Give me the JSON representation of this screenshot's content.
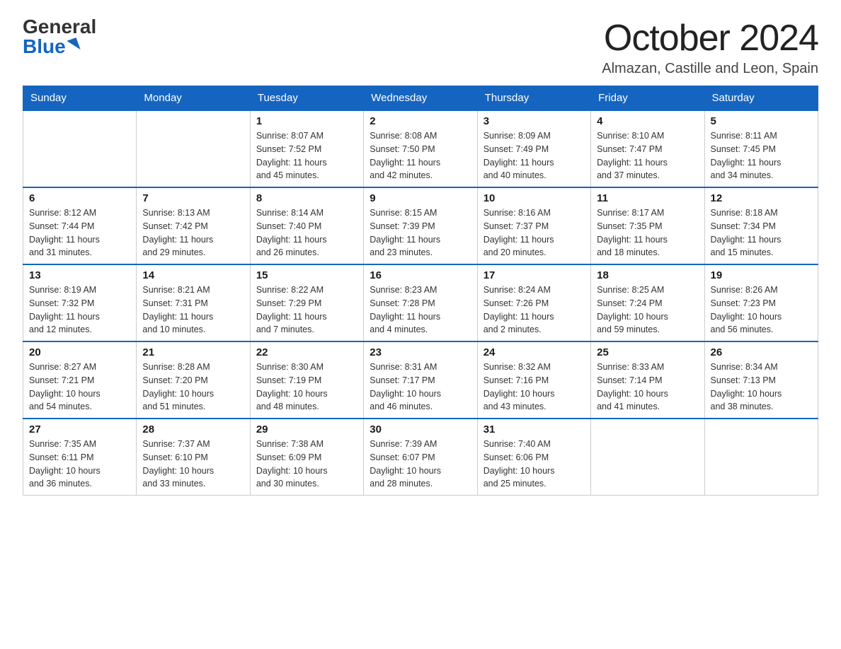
{
  "logo": {
    "general": "General",
    "blue": "Blue"
  },
  "title": {
    "month_year": "October 2024",
    "location": "Almazan, Castille and Leon, Spain"
  },
  "weekdays": [
    "Sunday",
    "Monday",
    "Tuesday",
    "Wednesday",
    "Thursday",
    "Friday",
    "Saturday"
  ],
  "weeks": [
    [
      {
        "day": "",
        "info": ""
      },
      {
        "day": "",
        "info": ""
      },
      {
        "day": "1",
        "info": "Sunrise: 8:07 AM\nSunset: 7:52 PM\nDaylight: 11 hours\nand 45 minutes."
      },
      {
        "day": "2",
        "info": "Sunrise: 8:08 AM\nSunset: 7:50 PM\nDaylight: 11 hours\nand 42 minutes."
      },
      {
        "day": "3",
        "info": "Sunrise: 8:09 AM\nSunset: 7:49 PM\nDaylight: 11 hours\nand 40 minutes."
      },
      {
        "day": "4",
        "info": "Sunrise: 8:10 AM\nSunset: 7:47 PM\nDaylight: 11 hours\nand 37 minutes."
      },
      {
        "day": "5",
        "info": "Sunrise: 8:11 AM\nSunset: 7:45 PM\nDaylight: 11 hours\nand 34 minutes."
      }
    ],
    [
      {
        "day": "6",
        "info": "Sunrise: 8:12 AM\nSunset: 7:44 PM\nDaylight: 11 hours\nand 31 minutes."
      },
      {
        "day": "7",
        "info": "Sunrise: 8:13 AM\nSunset: 7:42 PM\nDaylight: 11 hours\nand 29 minutes."
      },
      {
        "day": "8",
        "info": "Sunrise: 8:14 AM\nSunset: 7:40 PM\nDaylight: 11 hours\nand 26 minutes."
      },
      {
        "day": "9",
        "info": "Sunrise: 8:15 AM\nSunset: 7:39 PM\nDaylight: 11 hours\nand 23 minutes."
      },
      {
        "day": "10",
        "info": "Sunrise: 8:16 AM\nSunset: 7:37 PM\nDaylight: 11 hours\nand 20 minutes."
      },
      {
        "day": "11",
        "info": "Sunrise: 8:17 AM\nSunset: 7:35 PM\nDaylight: 11 hours\nand 18 minutes."
      },
      {
        "day": "12",
        "info": "Sunrise: 8:18 AM\nSunset: 7:34 PM\nDaylight: 11 hours\nand 15 minutes."
      }
    ],
    [
      {
        "day": "13",
        "info": "Sunrise: 8:19 AM\nSunset: 7:32 PM\nDaylight: 11 hours\nand 12 minutes."
      },
      {
        "day": "14",
        "info": "Sunrise: 8:21 AM\nSunset: 7:31 PM\nDaylight: 11 hours\nand 10 minutes."
      },
      {
        "day": "15",
        "info": "Sunrise: 8:22 AM\nSunset: 7:29 PM\nDaylight: 11 hours\nand 7 minutes."
      },
      {
        "day": "16",
        "info": "Sunrise: 8:23 AM\nSunset: 7:28 PM\nDaylight: 11 hours\nand 4 minutes."
      },
      {
        "day": "17",
        "info": "Sunrise: 8:24 AM\nSunset: 7:26 PM\nDaylight: 11 hours\nand 2 minutes."
      },
      {
        "day": "18",
        "info": "Sunrise: 8:25 AM\nSunset: 7:24 PM\nDaylight: 10 hours\nand 59 minutes."
      },
      {
        "day": "19",
        "info": "Sunrise: 8:26 AM\nSunset: 7:23 PM\nDaylight: 10 hours\nand 56 minutes."
      }
    ],
    [
      {
        "day": "20",
        "info": "Sunrise: 8:27 AM\nSunset: 7:21 PM\nDaylight: 10 hours\nand 54 minutes."
      },
      {
        "day": "21",
        "info": "Sunrise: 8:28 AM\nSunset: 7:20 PM\nDaylight: 10 hours\nand 51 minutes."
      },
      {
        "day": "22",
        "info": "Sunrise: 8:30 AM\nSunset: 7:19 PM\nDaylight: 10 hours\nand 48 minutes."
      },
      {
        "day": "23",
        "info": "Sunrise: 8:31 AM\nSunset: 7:17 PM\nDaylight: 10 hours\nand 46 minutes."
      },
      {
        "day": "24",
        "info": "Sunrise: 8:32 AM\nSunset: 7:16 PM\nDaylight: 10 hours\nand 43 minutes."
      },
      {
        "day": "25",
        "info": "Sunrise: 8:33 AM\nSunset: 7:14 PM\nDaylight: 10 hours\nand 41 minutes."
      },
      {
        "day": "26",
        "info": "Sunrise: 8:34 AM\nSunset: 7:13 PM\nDaylight: 10 hours\nand 38 minutes."
      }
    ],
    [
      {
        "day": "27",
        "info": "Sunrise: 7:35 AM\nSunset: 6:11 PM\nDaylight: 10 hours\nand 36 minutes."
      },
      {
        "day": "28",
        "info": "Sunrise: 7:37 AM\nSunset: 6:10 PM\nDaylight: 10 hours\nand 33 minutes."
      },
      {
        "day": "29",
        "info": "Sunrise: 7:38 AM\nSunset: 6:09 PM\nDaylight: 10 hours\nand 30 minutes."
      },
      {
        "day": "30",
        "info": "Sunrise: 7:39 AM\nSunset: 6:07 PM\nDaylight: 10 hours\nand 28 minutes."
      },
      {
        "day": "31",
        "info": "Sunrise: 7:40 AM\nSunset: 6:06 PM\nDaylight: 10 hours\nand 25 minutes."
      },
      {
        "day": "",
        "info": ""
      },
      {
        "day": "",
        "info": ""
      }
    ]
  ]
}
